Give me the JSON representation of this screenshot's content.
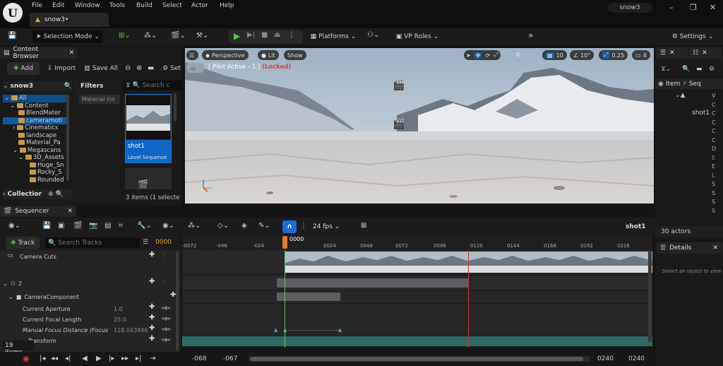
{
  "menubar": {
    "items": [
      "File",
      "Edit",
      "Window",
      "Tools",
      "Build",
      "Select",
      "Actor",
      "Help"
    ],
    "tab": "snow3•",
    "project": "snow3"
  },
  "toolbar": {
    "selection_mode": "Selection Mode",
    "platforms": "Platforms",
    "vp_roles": "VP Roles",
    "settings": "Settings"
  },
  "content_browser": {
    "title": "Content Browser",
    "add": "Add",
    "import": "Import",
    "save_all": "Save All",
    "settings_label": "Set",
    "root": "snow3",
    "filters": "Filters",
    "search_placeholder": "Search c",
    "filter_chip": "Material Ins",
    "tree": [
      "All",
      "Content",
      "BlendMater",
      "cameramoti",
      "Cinematics",
      "landscape",
      "Material_Pa",
      "Megascans",
      "3D_Assets",
      "Huge_Sn",
      "Rocky_S",
      "Rounded"
    ],
    "asset_name": "shot1",
    "asset_type": "Level Sequence",
    "items_count": "3 items (1 selecte",
    "collections": "Collectior"
  },
  "viewport": {
    "perspective": "Perspective",
    "lit": "Lit",
    "show": "Show",
    "pilot": "[ Pilot Active - 1 ]",
    "locked": "(Locked)",
    "grid": "10",
    "angle": "10°",
    "scale": "0.25",
    "cam": "4"
  },
  "outliner": {
    "item_col": "Item",
    "seq_col": "Seq",
    "shot": "shot1",
    "letters": [
      "V",
      "C",
      "C",
      "C",
      "C",
      "C",
      "D",
      "E",
      "E",
      "L",
      "S",
      "S",
      "S",
      "S"
    ],
    "actors": "30 actors"
  },
  "details": {
    "title": "Details",
    "hint": "Select an object to view de"
  },
  "sequencer": {
    "title": "Sequencer",
    "track": "Track",
    "search_placeholder": "Search Tracks",
    "frame": "0000",
    "fps": "24 fps",
    "shot": "shot1",
    "playhead": "0000",
    "ruler": [
      "-0072",
      "-048",
      "-024",
      "0024",
      "0048",
      "0072",
      "0096",
      "0120",
      "0144",
      "0168",
      "0192",
      "0216"
    ],
    "tracks": [
      {
        "label": "Camera Cuts"
      },
      {
        "label": "2"
      },
      {
        "label": "CameraComponent"
      },
      {
        "label": "Current Aperture",
        "value": "1.0"
      },
      {
        "label": "Current Focal Length",
        "value": "25.0"
      },
      {
        "label": "Manual Focus Distance (Focus",
        "value": "118.043846"
      },
      {
        "label": "Transform"
      }
    ],
    "items_count": "19 items",
    "range": {
      "start_a": "-068",
      "start_b": "-067",
      "end_a": "0240",
      "end_b": "0240"
    }
  }
}
